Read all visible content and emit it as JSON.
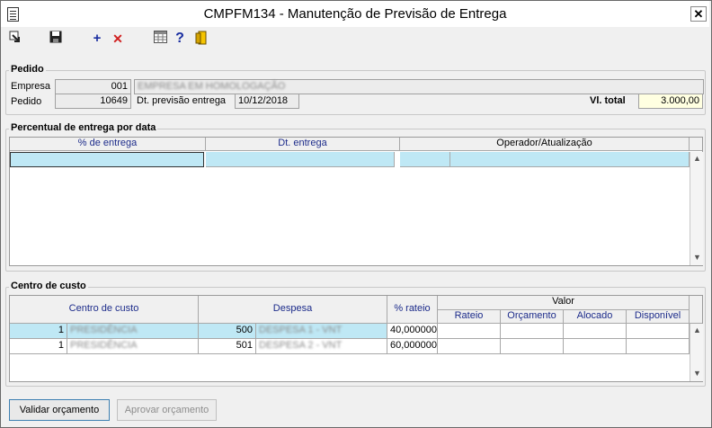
{
  "window": {
    "title": "CMPFM134 - Manutenção de Previsão de Entrega",
    "close_symbol": "✕"
  },
  "toolbar": {
    "add_symbol": "+",
    "delete_symbol": "✕",
    "help_symbol": "?"
  },
  "pedido": {
    "group_title": "Pedido",
    "empresa_label": "Empresa",
    "empresa_code": "001",
    "empresa_name": "EMPRESA EM HOMOLOGAÇÃO",
    "pedido_label": "Pedido",
    "pedido_number": "10649",
    "dt_label": "Dt. previsão entrega",
    "dt_value": "10/12/2018",
    "total_label": "Vl. total",
    "total_value": "3.000,00"
  },
  "percentual": {
    "group_title": "Percentual de entrega por data",
    "col_pct": "% de entrega",
    "col_dt": "Dt. entrega",
    "col_oper": "Operador/Atualização"
  },
  "centro": {
    "group_title": "Centro de custo",
    "col_centro": "Centro de custo",
    "col_despesa": "Despesa",
    "col_rateio_pct": "% rateio",
    "col_valor": "Valor",
    "col_rateio": "Rateio",
    "col_orcamento": "Orçamento",
    "col_alocado": "Alocado",
    "col_disponivel": "Disponível",
    "rows": [
      {
        "cc_code": "1",
        "cc_name": "PRESIDÊNCIA",
        "desp_code": "500",
        "desp_name": "DESPESA 1 - VNT",
        "pct": "40,000000",
        "rateio": "",
        "orcamento": "",
        "alocado": "",
        "disponivel": ""
      },
      {
        "cc_code": "1",
        "cc_name": "PRESIDÊNCIA",
        "desp_code": "501",
        "desp_name": "DESPESA 2 - VNT",
        "pct": "60,000000",
        "rateio": "",
        "orcamento": "",
        "alocado": "",
        "disponivel": ""
      }
    ]
  },
  "buttons": {
    "validar": "Validar orçamento",
    "aprovar": "Aprovar orçamento"
  },
  "colors": {
    "selection": "#bfe8f5",
    "total_bg": "#ffffe1",
    "header_text": "#1c2b8a"
  }
}
